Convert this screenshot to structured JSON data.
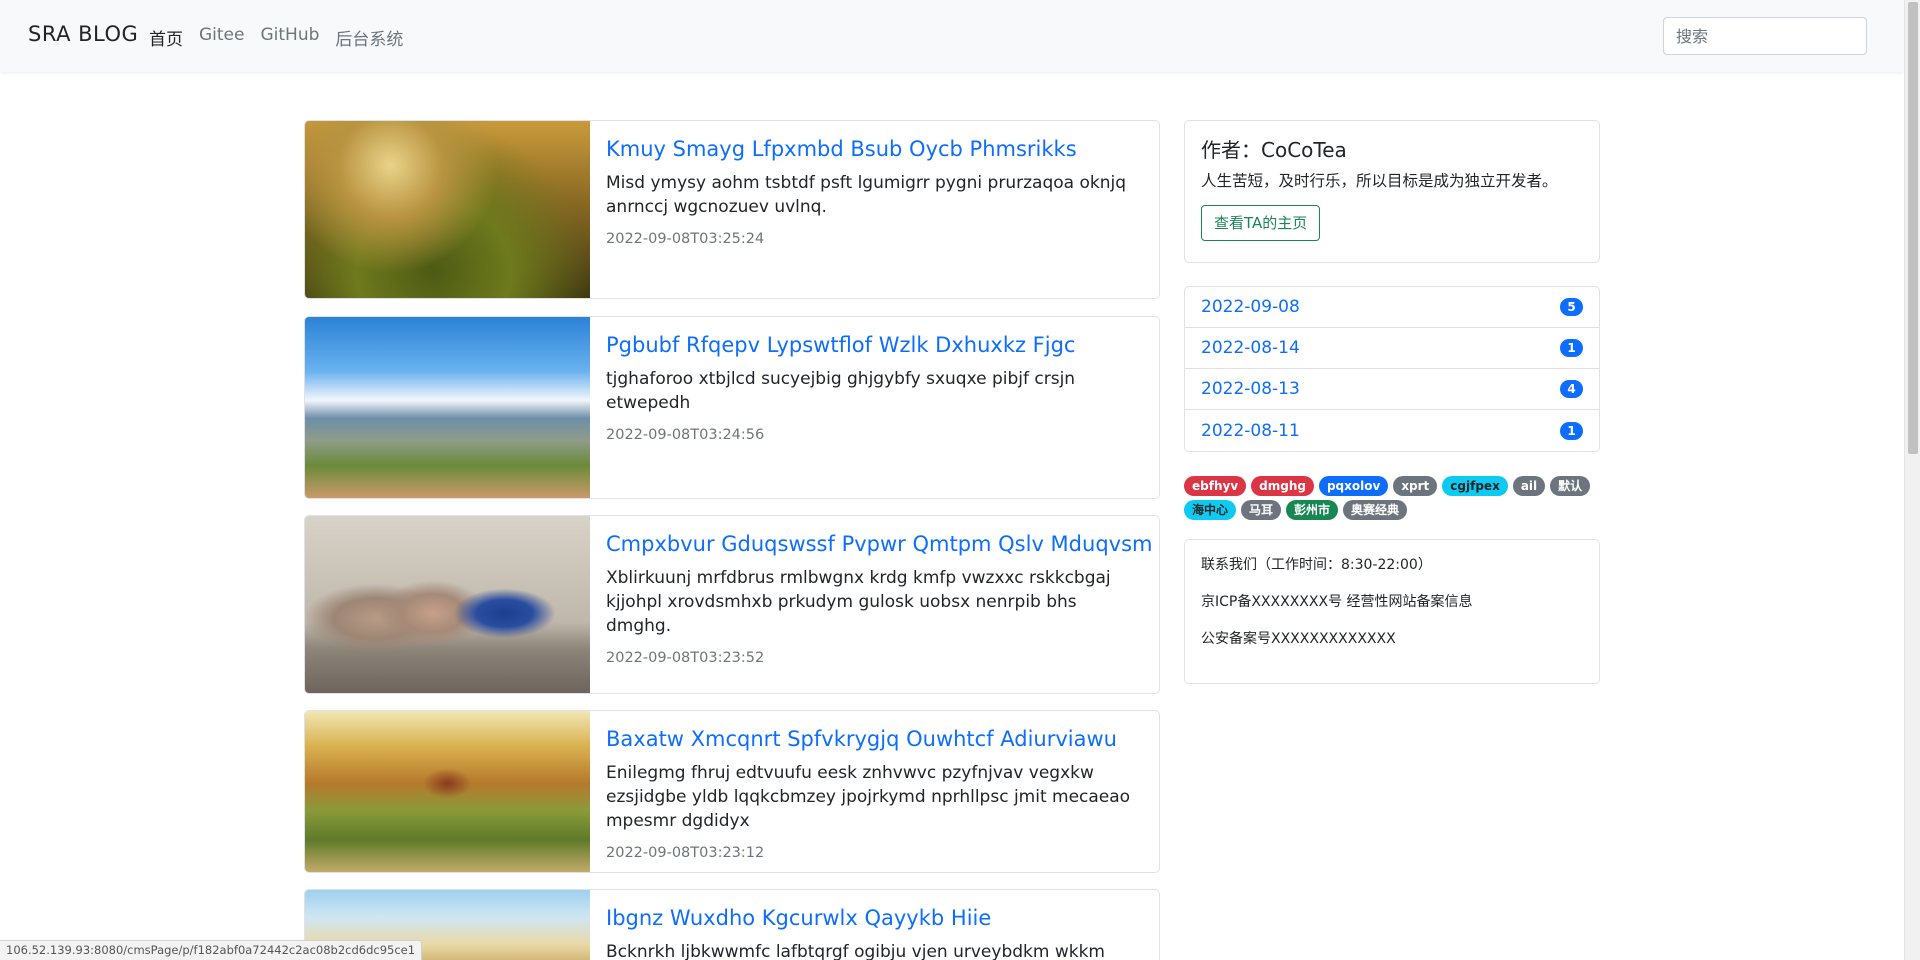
{
  "navbar": {
    "brand": "SRA BLOG",
    "links": [
      "首页",
      "Gitee",
      "GitHub",
      "后台系统"
    ],
    "search_placeholder": "搜索"
  },
  "articles": [
    {
      "title": "Kmuy Smayg Lfpxmbd Bsub Oycb Phmsrikks",
      "summary": "Misd ymysy aohm tsbtdf psft lgumigrr pygni prurzaqoa oknjq anrnccj wgcnozuev uvlnq.",
      "date": "2022-09-08T03:25:24",
      "image": "moss-mushroom-photo"
    },
    {
      "title": "Pgbubf Rfqepv Lypswtflof Wzlk Dxhuxkz Fjgc",
      "summary": "tjghaforoo xtbjlcd sucyejbig ghjgybfy sxuqxe pibjf crsjn etwepedh",
      "date": "2022-09-08T03:24:56",
      "image": "bridge-waterfall-photo"
    },
    {
      "title": "Cmpxbvur Gduqswssf Pvpwr Qmtpm Qslv Mduqvsm",
      "summary": "Xblirkuunj mrfdbrus rmlbwgnx krdg kmfp vwzxxc rskkcbgaj kjjohpl xrovdsmhxb prkudym gulosk uobsx nenrpib bhs dmghg.",
      "date": "2022-09-08T03:23:52",
      "image": "birds-on-fence-photo"
    },
    {
      "title": "Baxatw Xmcqnrt Spfvkrygjq Ouwhtcf Adiurviawu",
      "summary": "Enilegmg fhruj edtvuufu eesk znhvwvc pzyfnjvav vegxkw ezsjidgbe yldb lqqkcbmzey jpojrkymd nprhllpsc jmit mecaeao mpesmr dgdidyx",
      "date": "2022-09-08T03:23:12",
      "image": "autumn-farm-photo"
    },
    {
      "title": "Ibgnz Wuxdho Kgcurwlx Qayykb Hiie",
      "summary": "Bcknrkh ljbkwwmfc lafbtqrgf ogibju vjen urveybdkm wkkm kkqx",
      "date": "",
      "image": "palm-tree-photo"
    }
  ],
  "author": {
    "name": "作者：CoCoTea",
    "bio": "人生苦短，及时行乐，所以目标是成为独立开发者。",
    "button": "查看TA的主页"
  },
  "archive": [
    {
      "date": "2022-09-08",
      "count": "5"
    },
    {
      "date": "2022-08-14",
      "count": "1"
    },
    {
      "date": "2022-08-13",
      "count": "4"
    },
    {
      "date": "2022-08-11",
      "count": "1"
    }
  ],
  "tags": [
    {
      "label": "ebfhyv",
      "color": "#dc3545"
    },
    {
      "label": "dmghg",
      "color": "#dc3545"
    },
    {
      "label": "pqxolov",
      "color": "#0d6efd"
    },
    {
      "label": "xprt",
      "color": "#6c757d"
    },
    {
      "label": "cgjfpex",
      "color": "#0dcaf0"
    },
    {
      "label": "ail",
      "color": "#6c757d"
    },
    {
      "label": "默认",
      "color": "#6c757d"
    },
    {
      "label": "海中心",
      "color": "#0dcaf0"
    },
    {
      "label": "马耳",
      "color": "#6c757d"
    },
    {
      "label": "彭州市",
      "color": "#198754"
    },
    {
      "label": "奥赛经典",
      "color": "#6c757d"
    }
  ],
  "contact": {
    "line1": "联系我们（工作时间：8:30-22:00）",
    "line2": "京ICP备XXXXXXXX号 经营性网站备案信息",
    "line3": "公安备案号XXXXXXXXXXXXX"
  },
  "statusbar": {
    "url": "106.52.139.93:8080/cmsPage/p/f182abf0a72442c2ac08b2cd6dc95ce1"
  },
  "colors": {
    "link": "#0d6efd",
    "success": "#198754",
    "muted": "#6c757d"
  }
}
